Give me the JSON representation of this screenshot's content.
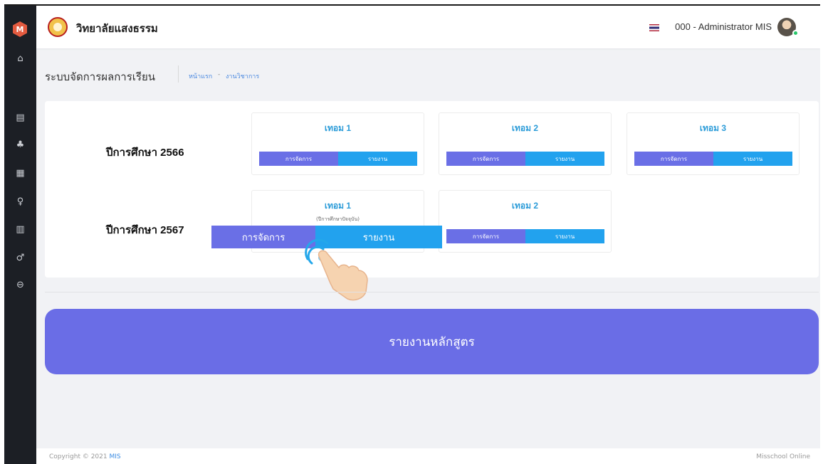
{
  "sidebar": {
    "logo_letter": "M",
    "items": [
      {
        "name": "home-icon",
        "glyph": "⌂"
      },
      {
        "name": "document-icon",
        "glyph": "▤"
      },
      {
        "name": "users-icon",
        "glyph": "♣"
      },
      {
        "name": "calendar-icon",
        "glyph": "▦"
      },
      {
        "name": "user-edit-icon",
        "glyph": "♀"
      },
      {
        "name": "book-icon",
        "glyph": "▥"
      },
      {
        "name": "user-settings-icon",
        "glyph": "♂"
      },
      {
        "name": "logout-icon",
        "glyph": "⊖"
      }
    ]
  },
  "header": {
    "school_name": "วิทยาลัยแสงธรรม",
    "user_name": "000 - Administrator MIS"
  },
  "page": {
    "title": "ระบบจัดการผลการเรียน",
    "breadcrumb_home": "หน้าแรก",
    "breadcrumb_sep": "-",
    "breadcrumb_current": "งานวิชาการ"
  },
  "years": [
    {
      "label": "ปีการศึกษา 2566",
      "terms": [
        {
          "title": "เทอม 1",
          "manage": "การจัดการ",
          "report": "รายงาน"
        },
        {
          "title": "เทอม 2",
          "manage": "การจัดการ",
          "report": "รายงาน"
        },
        {
          "title": "เทอม 3",
          "manage": "การจัดการ",
          "report": "รายงาน"
        }
      ]
    },
    {
      "label": "ปีการศึกษา 2567",
      "terms": [
        {
          "title": "เทอม 1",
          "subtitle": "(ปีการศึกษาปัจจุบัน)",
          "manage": "การจัดการ",
          "report": "รายงาน"
        },
        {
          "title": "เทอม 2",
          "manage": "การจัดการ",
          "report": "รายงาน"
        }
      ]
    }
  ],
  "course_report_label": "รายงานหลักสูตร",
  "footer": {
    "copyright_prefix": "Copyright © 2021",
    "copyright_brand": "MIS",
    "product": "Misschool Online"
  },
  "colors": {
    "manage": "#6a6fe6",
    "report": "#22a2ee",
    "term_title": "#2a9bd8",
    "sidebar": "#1c1f25"
  }
}
